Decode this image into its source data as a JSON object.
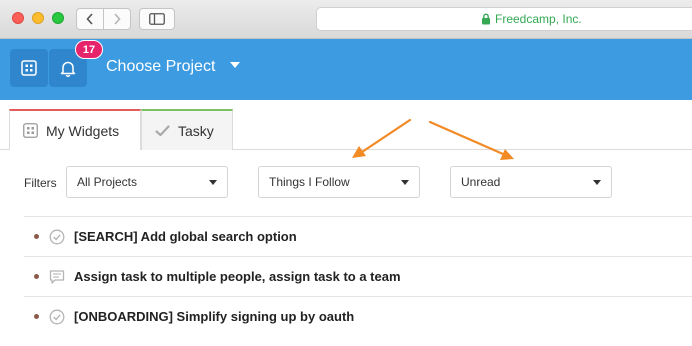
{
  "browser": {
    "url_text": "Freedcamp, Inc."
  },
  "header": {
    "notification_count": "17",
    "project_selector_label": "Choose Project"
  },
  "tabs": [
    {
      "label": "My Widgets"
    },
    {
      "label": "Tasky"
    }
  ],
  "filters": {
    "label": "Filters",
    "project": "All Projects",
    "scope": "Things I Follow",
    "status": "Unread"
  },
  "tasks": [
    {
      "title": "[SEARCH] Add global search option",
      "icon": "check-circle-icon"
    },
    {
      "title": "Assign task to multiple people, assign task to a team",
      "icon": "comment-icon"
    },
    {
      "title": "[ONBOARDING] Simplify signing up by oauth",
      "icon": "check-circle-icon"
    }
  ],
  "colors": {
    "header_blue": "#3c9be1",
    "badge_pink": "#e6246b",
    "arrow_orange": "#f28a25",
    "url_green": "#34a853"
  }
}
